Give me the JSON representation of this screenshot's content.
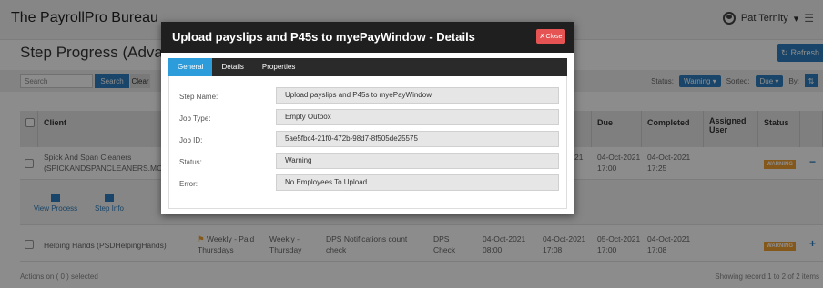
{
  "app": {
    "brand": "The PayrollPro Bureau",
    "user_name": "Pat Ternity",
    "user_caret": "▾",
    "menu_glyph": "☰",
    "page_title": "Step Progress (Advan",
    "refresh_label": "Refresh"
  },
  "toolbar": {
    "search_placeholder": "Search",
    "search_label": "Search",
    "clear_label": "Clear",
    "status_label": "Status:",
    "status_value": "Warning ▾",
    "sorted_label": "Sorted:",
    "sorted_value": "Due ▾",
    "by_label": "By:",
    "by_value": "⇅"
  },
  "grid": {
    "headers": {
      "client": "Client",
      "due": "Due",
      "completed": "Completed",
      "assigned": "Assigned User",
      "status": "Status"
    },
    "row1": {
      "client": "Spick And Span Cleaners (SPICKANDSPANCLEANERS.MCP)",
      "partial": "21",
      "due": "04-Oct-2021 17:00",
      "completed": "04-Oct-2021 17:25",
      "status": "WARNING",
      "action": "−"
    },
    "sub": {
      "view_process": "View Process",
      "step_info": "Step Info"
    },
    "row2": {
      "client": "Helping Hands (PSDHelpingHands)",
      "schedule": "Weekly - Paid Thursdays",
      "frequency": "Weekly - Thursday",
      "step": "DPS Notifications count check",
      "type": "DPS Check",
      "start": "04-Oct-2021 08:00",
      "end": "04-Oct-2021 17:08",
      "due": "05-Oct-2021 17:00",
      "completed": "04-Oct-2021 17:08",
      "status": "WARNING",
      "action": "+"
    },
    "footer_left": "Actions on ( 0 ) selected",
    "footer_right": "Showing record 1 to 2 of 2 items"
  },
  "modal": {
    "title": "Upload payslips and P45s to myePayWindow - Details",
    "close_label": "Close",
    "close_glyph": "✗",
    "tabs": [
      "General",
      "Details",
      "Properties"
    ],
    "fields": {
      "step_name": {
        "label": "Step Name:",
        "value": "Upload payslips and P45s to myePayWindow"
      },
      "job_type": {
        "label": "Job Type:",
        "value": "Empty Outbox"
      },
      "job_id": {
        "label": "Job ID:",
        "value": "5ae5fbc4-21f0-472b-98d7-8f505de25575"
      },
      "status": {
        "label": "Status:",
        "value": "Warning"
      },
      "error": {
        "label": "Error:",
        "value": "No Employees To Upload"
      }
    }
  },
  "colors": {
    "accent_blue": "#2d7fbf",
    "tab_active": "#2d9cdb",
    "modal_header": "#1f1f1f",
    "close_red": "#e55353",
    "warning_orange": "#f0a030"
  }
}
